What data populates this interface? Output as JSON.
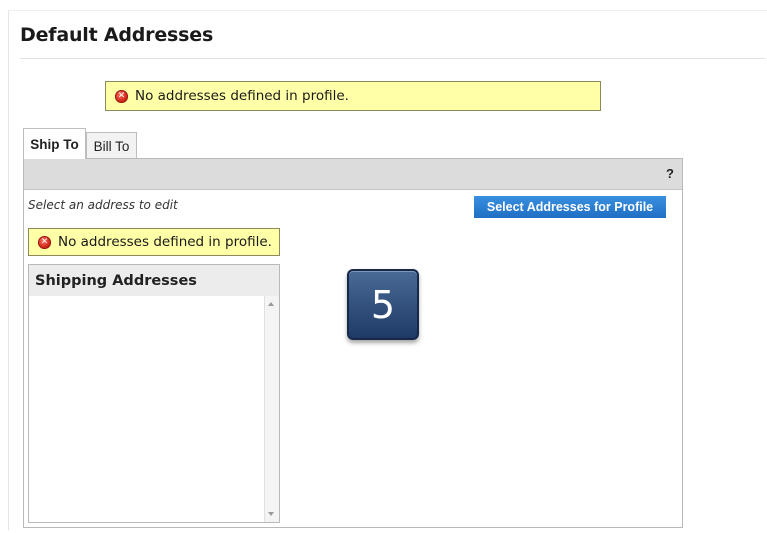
{
  "page": {
    "title": "Default Addresses"
  },
  "alerts": {
    "top_message": "No addresses defined in profile.",
    "inner_message": "No addresses defined in profile."
  },
  "tabs": [
    {
      "label": "Ship To",
      "active": true
    },
    {
      "label": "Bill To",
      "active": false
    }
  ],
  "panel": {
    "help_label": "?",
    "hint": "Select an address to edit",
    "select_button_label": "Select Addresses for Profile"
  },
  "shipping_list": {
    "header": "Shipping Addresses",
    "items": []
  },
  "step_badge": {
    "number": "5"
  },
  "icons": {
    "error": "error-circle-icon",
    "scroll_up": "scroll-up-arrow-icon",
    "scroll_down": "scroll-down-arrow-icon"
  },
  "colors": {
    "alert_background": "#ffffa8",
    "button_blue": "#2a7fd4",
    "badge_navy": "#2f4c7a",
    "panel_bar": "#dcdcdc"
  }
}
